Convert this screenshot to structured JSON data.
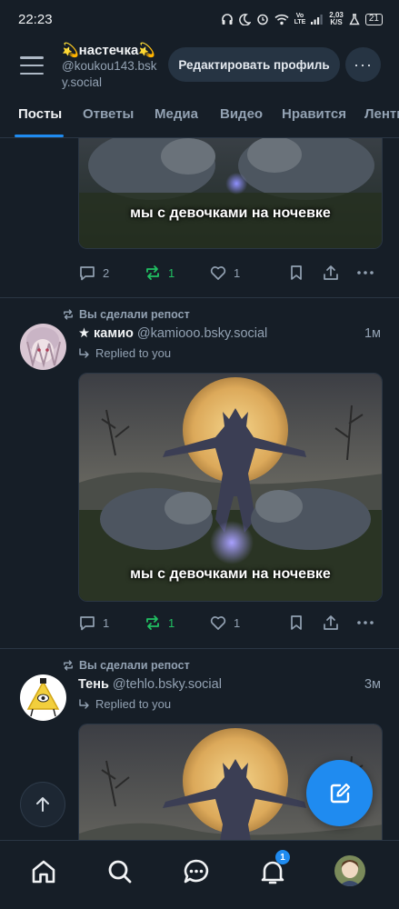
{
  "status_bar": {
    "time": "22:23",
    "net_speed_value": "2,03",
    "net_speed_unit": "K/S",
    "volte_top": "Vo",
    "volte_bottom": "LTE",
    "battery": "21"
  },
  "header": {
    "profile_name": "💫настечка💫",
    "profile_handle": "@koukou143.bsky.social",
    "edit_profile_label": "Редактировать профиль",
    "more_label": "···"
  },
  "tabs": [
    {
      "label": "Посты",
      "active": true
    },
    {
      "label": "Ответы"
    },
    {
      "label": "Медиа"
    },
    {
      "label": "Видео"
    },
    {
      "label": "Нравится"
    },
    {
      "label": "Ленты"
    }
  ],
  "posts": [
    {
      "image_caption": "мы с девочками на ночевке",
      "replies": "2",
      "reposts": "1",
      "likes": "1"
    },
    {
      "repost_label": "Вы сделали репост",
      "author_name": "★ камио",
      "author_handle": "@kamiooo.bsky.social",
      "time": "1м",
      "reply_label": "Replied to you",
      "image_caption": "мы с девочками на ночевке",
      "replies": "1",
      "reposts": "1",
      "likes": "1"
    },
    {
      "repost_label": "Вы сделали репост",
      "author_name": "Тень",
      "author_handle": "@tehlo.bsky.social",
      "time": "3м",
      "reply_label": "Replied to you"
    }
  ],
  "bottom_nav": {
    "items": [
      "home-icon",
      "search-icon",
      "chat-icon",
      "bell-icon",
      "profile-avatar"
    ],
    "notification_badge": "1"
  },
  "colors": {
    "background": "#161e27",
    "accent": "#1f8bf0",
    "repost_green": "#21c063",
    "muted_text": "#93a2b3"
  }
}
